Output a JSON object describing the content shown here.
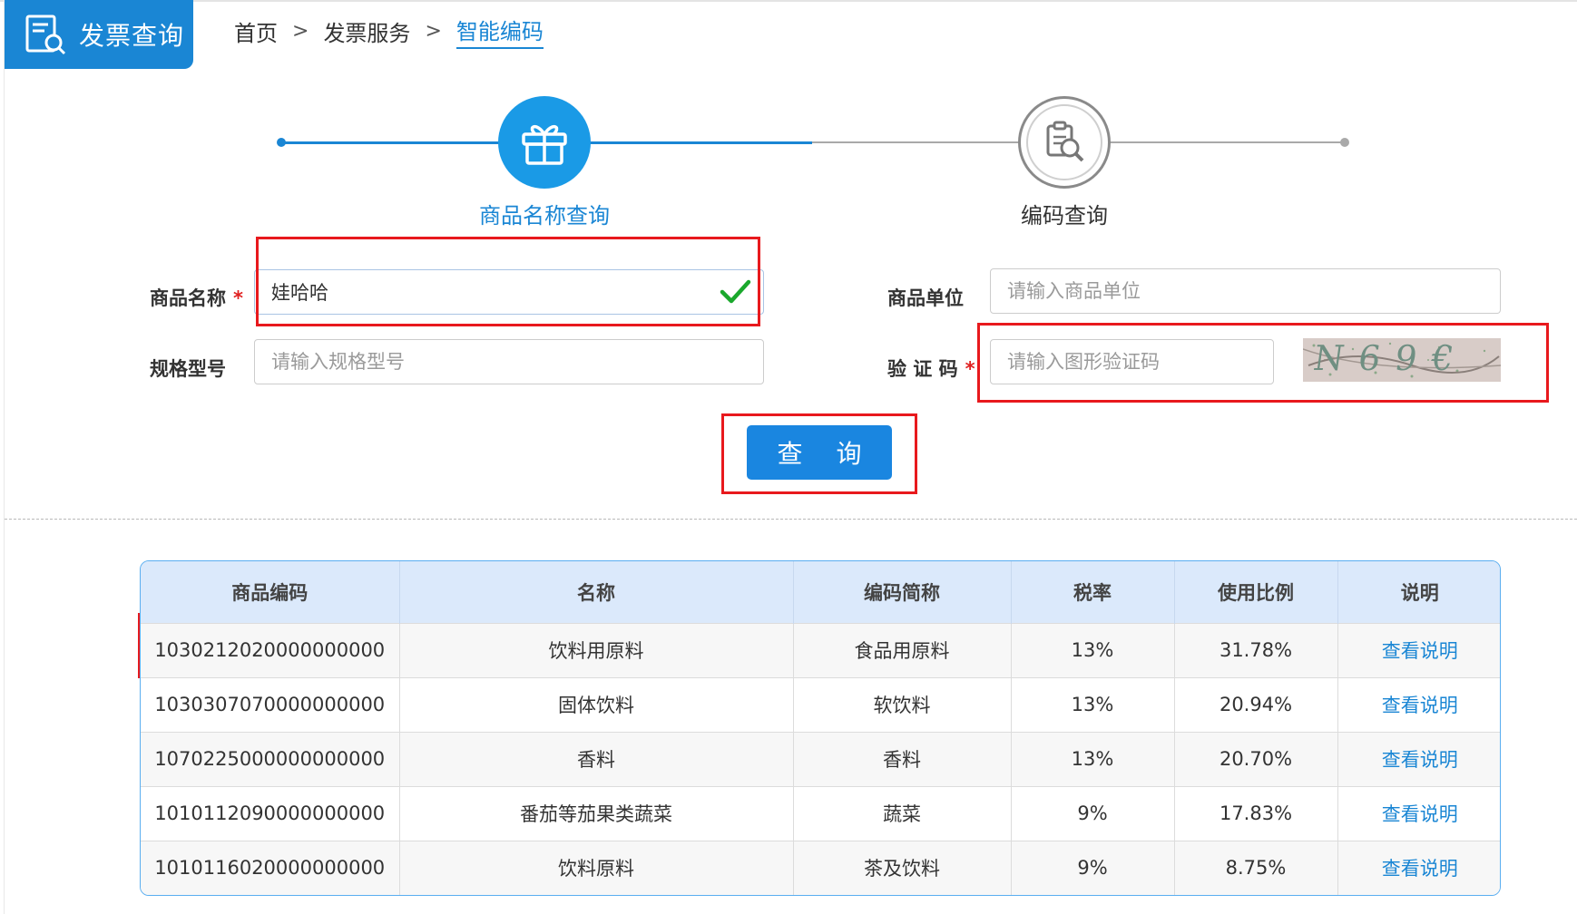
{
  "header": {
    "app_title": "发票查询",
    "breadcrumb": [
      "首页",
      "发票服务",
      "智能编码"
    ],
    "breadcrumb_sep": ">"
  },
  "steps": [
    {
      "label": "商品名称查询",
      "active": true,
      "icon": "gift-icon"
    },
    {
      "label": "编码查询",
      "active": false,
      "icon": "document-search-icon"
    }
  ],
  "form": {
    "product_name": {
      "label": "商品名称",
      "required_mark": "*",
      "value": "娃哈哈"
    },
    "spec_model": {
      "label": "规格型号",
      "placeholder": "请输入规格型号"
    },
    "product_unit": {
      "label": "商品单位",
      "placeholder": "请输入商品单位"
    },
    "captcha": {
      "label": "验 证 码",
      "required_mark": "*",
      "placeholder": "请输入图形验证码",
      "image_text": "N69€"
    },
    "query_button": "查 询"
  },
  "table": {
    "headers": [
      "商品编码",
      "名称",
      "编码简称",
      "税率",
      "使用比例",
      "说明"
    ],
    "rows": [
      [
        "1030212020000000000",
        "饮料用原料",
        "食品用原料",
        "13%",
        "31.78%",
        "查看说明"
      ],
      [
        "1030307070000000000",
        "固体饮料",
        "软饮料",
        "13%",
        "20.94%",
        "查看说明"
      ],
      [
        "1070225000000000000",
        "香料",
        "香料",
        "13%",
        "20.70%",
        "查看说明"
      ],
      [
        "1010112090000000000",
        "番茄等茄果类蔬菜",
        "蔬菜",
        "9%",
        "17.83%",
        "查看说明"
      ],
      [
        "1010116020000000000",
        "饮料原料",
        "茶及饮料",
        "9%",
        "8.75%",
        "查看说明"
      ]
    ]
  },
  "colors": {
    "primary": "#1a86d4",
    "highlight_box": "#e8191d",
    "valid_check": "#1aa82c"
  }
}
